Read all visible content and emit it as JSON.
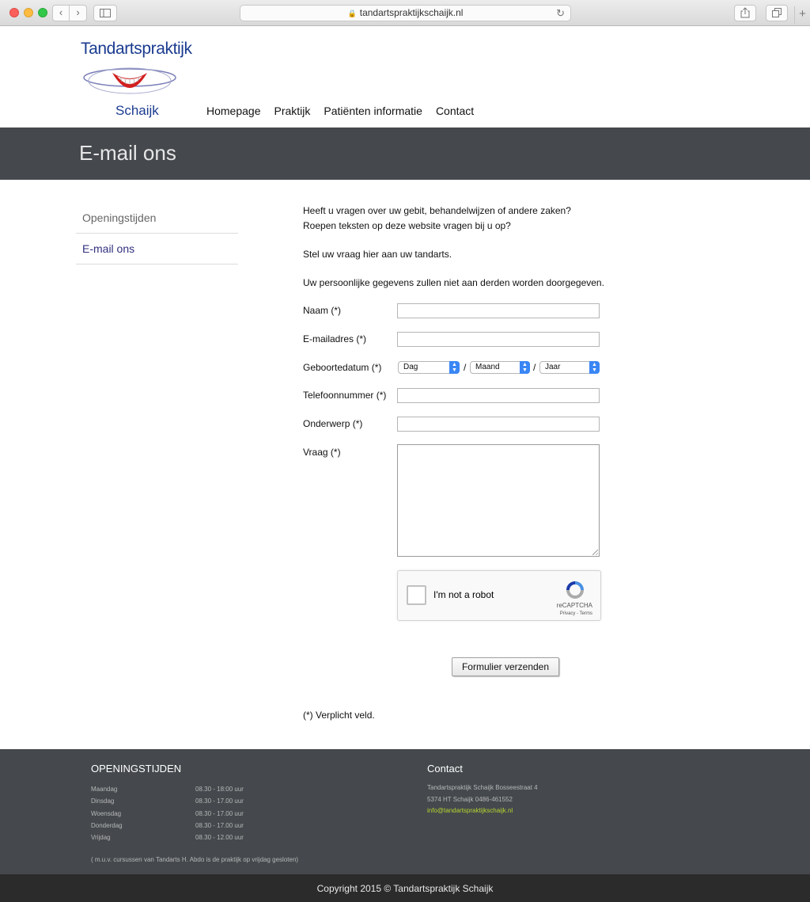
{
  "browser": {
    "url": "tandartspraktijkschaijk.nl",
    "back": "‹",
    "forward": "›",
    "reload": "↻",
    "new_tab": "+"
  },
  "header": {
    "logo_top": "Tandartspraktijk",
    "logo_bottom": "Schaijk",
    "nav": [
      "Homepage",
      "Praktijk",
      "Patiënten informatie",
      "Contact"
    ]
  },
  "page": {
    "title": "E-mail ons"
  },
  "sidemenu": {
    "items": [
      "Openingstijden",
      "E-mail ons"
    ]
  },
  "intro": {
    "line1": "Heeft u vragen over uw gebit, behandelwijzen of andere zaken?",
    "line2": "Roepen teksten op deze website vragen bij u op?",
    "line3": "Stel uw vraag hier aan uw tandarts.",
    "line4": "Uw persoonlijke gegevens zullen niet aan derden worden doorgegeven."
  },
  "form": {
    "name_label": "Naam (*)",
    "email_label": "E-mailadres (*)",
    "birth_label": "Geboortedatum (*)",
    "day_value": "Dag",
    "month_value": "Maand",
    "year_value": "Jaar",
    "slash": "/",
    "phone_label": "Telefoonnummer (*)",
    "subject_label": "Onderwerp (*)",
    "question_label": "Vraag (*)",
    "recaptcha_text": "I'm not a robot",
    "recaptcha_brand": "reCAPTCHA",
    "recaptcha_terms": "Privacy - Terms",
    "submit": "Formulier verzenden",
    "required_note": "(*) Verplicht veld."
  },
  "footer": {
    "hours_title": "OPENINGSTIJDEN",
    "hours": [
      {
        "day": "Maandag",
        "time": "08.30 - 18:00 uur"
      },
      {
        "day": "Dinsdag",
        "time": "08.30 - 17.00 uur"
      },
      {
        "day": "Woensdag",
        "time": "08.30 - 17.00 uur"
      },
      {
        "day": "Donderdag",
        "time": "08.30 - 17.00 uur"
      },
      {
        "day": "Vrijdag",
        "time": "08.30 - 12.00 uur"
      }
    ],
    "hours_note": "( m.u.v. cursussen van Tandarts H. Abdo is de praktijk op vrijdag gesloten)",
    "contact_title": "Contact",
    "contact_line1": "Tandartspraktijk Schaijk Bosseestraat 4",
    "contact_line2": "5374 HT Schaijk 0486-461552",
    "contact_email": "info@tandartspraktijkschaijk.nl"
  },
  "copyright": "Copyright 2015 © Tandartspraktijk Schaijk",
  "colors": {
    "title_band": "#45494d",
    "link_active": "#31307f",
    "footer_mail": "#b7d430",
    "copyright_bar": "#2b2b2b"
  }
}
